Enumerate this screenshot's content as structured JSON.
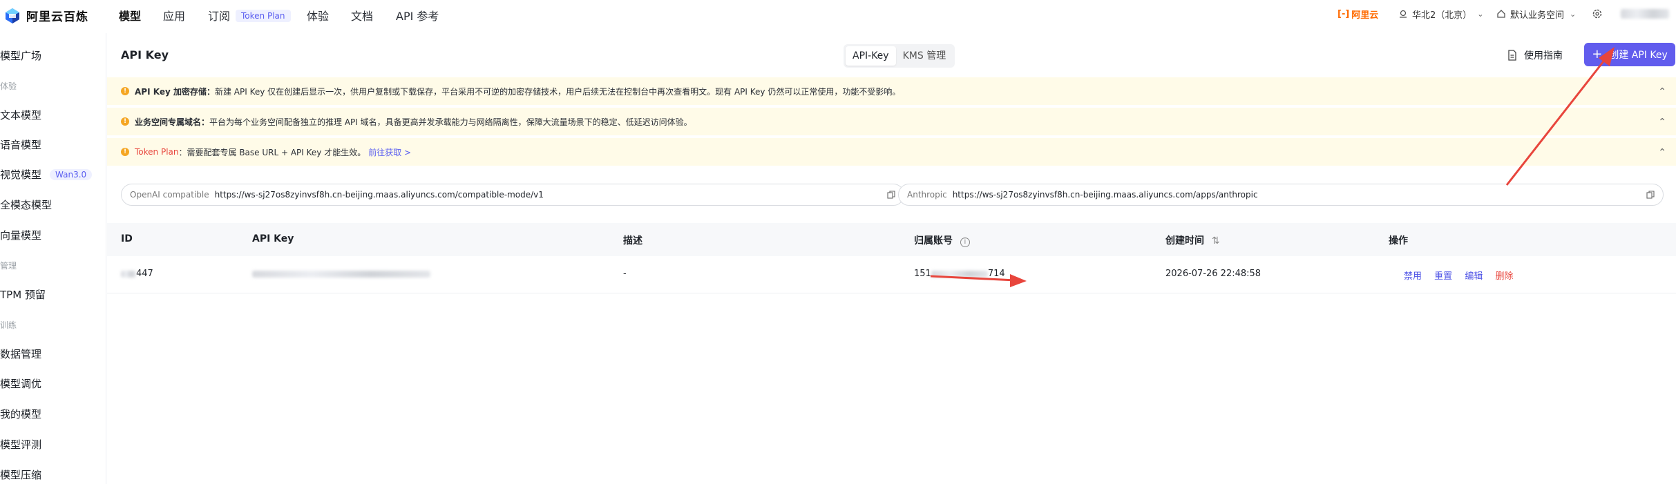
{
  "brand": {
    "name": "阿里云百炼"
  },
  "nav": {
    "items": [
      {
        "label": "模型",
        "active": true
      },
      {
        "label": "应用"
      },
      {
        "label": "订阅",
        "badge": "Token Plan"
      },
      {
        "label": "体验"
      },
      {
        "label": "文档"
      },
      {
        "label": "API 参考"
      }
    ]
  },
  "topright": {
    "aliyun": "阿里云",
    "region": "华北2（北京）",
    "workspace": "默认业务空间"
  },
  "sidebar": {
    "items": [
      {
        "label": "模型广场"
      },
      {
        "group": "体验"
      },
      {
        "label": "文本模型"
      },
      {
        "label": "语音模型"
      },
      {
        "label": "视觉模型",
        "badge": "Wan3.0"
      },
      {
        "label": "全模态模型"
      },
      {
        "label": "向量模型"
      },
      {
        "group": "管理"
      },
      {
        "label": "TPM 预留"
      },
      {
        "group": "训练"
      },
      {
        "label": "数据管理"
      },
      {
        "label": "模型调优"
      },
      {
        "label": "我的模型"
      },
      {
        "label": "模型评测"
      },
      {
        "label": "模型压缩"
      }
    ]
  },
  "page": {
    "title": "API Key",
    "tabs": [
      "API-Key",
      "KMS 管理"
    ],
    "guide_label": "使用指南",
    "create_label": "创建 API Key"
  },
  "notices": [
    {
      "title": "API Key 加密存储：",
      "text": "新建 API Key 仅在创建后显示一次，供用户复制或下载保存，平台采用不可逆的加密存储技术，用户后续无法在控制台中再次查看明文。现有 API Key 仍然可以正常使用，功能不受影响。"
    },
    {
      "title": "业务空间专属域名：",
      "text": "平台为每个业务空间配备独立的推理 API 域名，具备更高并发承载能力与网络隔离性，保障大流量场景下的稳定、低延迟访问体验。"
    },
    {
      "title": "Token Plan",
      "text": "：需要配套专属 Base URL + API Key 才能生效。",
      "link": "前往获取 >"
    }
  ],
  "endpoints": [
    {
      "label": "OpenAI compatible",
      "url": "https://ws-sj27os8zyinvsf8h.cn-beijing.maas.aliyuncs.com/compatible-mode/v1"
    },
    {
      "label": "Anthropic",
      "url": "https://ws-sj27os8zyinvsf8h.cn-beijing.maas.aliyuncs.com/apps/anthropic"
    }
  ],
  "table": {
    "headers": [
      "ID",
      "API Key",
      "描述",
      "归属账号",
      "创建时间",
      "操作"
    ],
    "rows": [
      {
        "id_suffix": "447",
        "description": "-",
        "account_prefix": "151",
        "account_suffix": "714",
        "created": "2026-07-26 22:48:58",
        "actions": [
          "禁用",
          "重置",
          "编辑",
          "删除"
        ]
      }
    ]
  }
}
